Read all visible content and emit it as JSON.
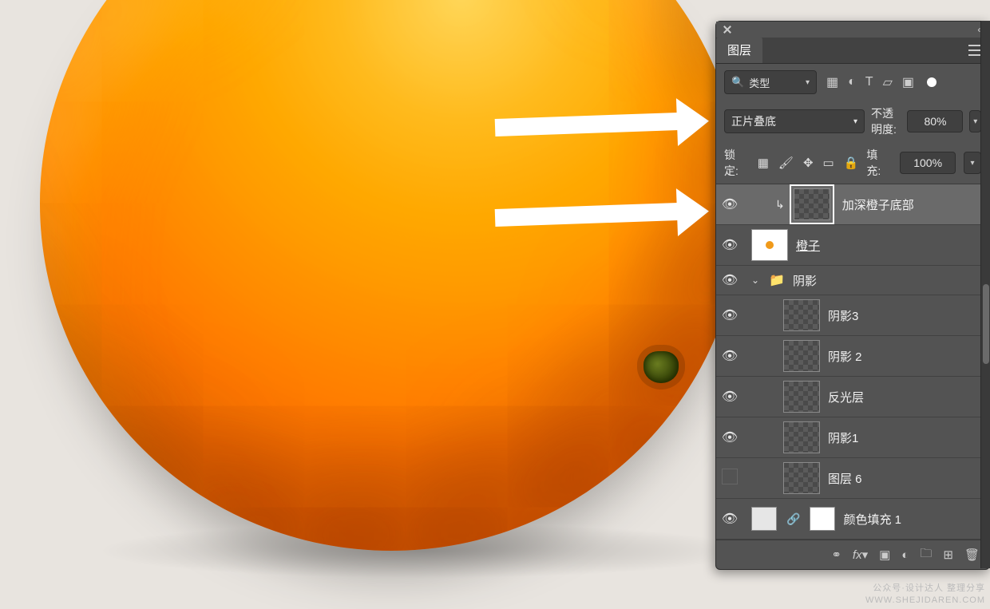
{
  "panel": {
    "tab_label": "图层",
    "filter_label": "类型",
    "blend_mode": "正片叠底",
    "opacity_label": "不透明度:",
    "opacity_value": "80%",
    "lock_label": "锁定:",
    "fill_label": "填充:",
    "fill_value": "100%"
  },
  "layers": [
    {
      "name": "加深橙子底部",
      "visible": true,
      "selected": true,
      "clipped": true,
      "thumb": "checker"
    },
    {
      "name": "橙子",
      "visible": true,
      "thumb": "orange",
      "linked": true
    },
    {
      "name": "阴影",
      "visible": true,
      "type": "group",
      "expanded": true
    },
    {
      "name": "阴影3",
      "visible": true,
      "thumb": "checker",
      "indent": 2
    },
    {
      "name": "阴影 2",
      "visible": true,
      "thumb": "checker",
      "indent": 2
    },
    {
      "name": "反光层",
      "visible": true,
      "thumb": "checker",
      "indent": 2
    },
    {
      "name": "阴影1",
      "visible": true,
      "thumb": "checker",
      "indent": 2
    },
    {
      "name": "图层 6",
      "visible": false,
      "thumb": "checker",
      "indent": 2
    },
    {
      "name": "颜色填充 1",
      "visible": true,
      "thumb": "solid",
      "fill_layer": true
    }
  ],
  "watermark": {
    "line1": "公众号·设计达人 整理分享",
    "line2": "WWW.SHEJIDAREN.COM"
  }
}
